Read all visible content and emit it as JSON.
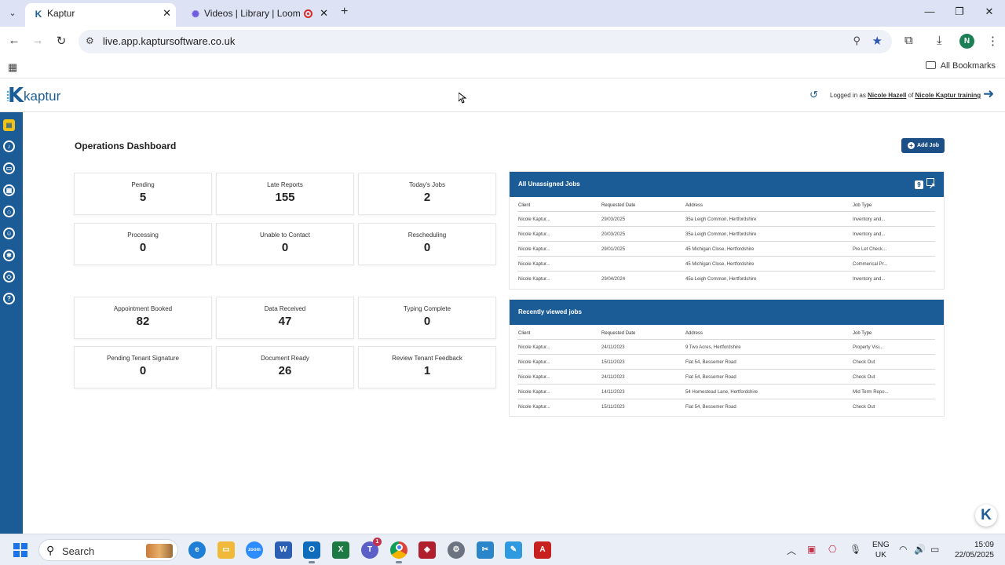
{
  "browser": {
    "tabs": [
      {
        "title": "Kaptur",
        "active": true
      },
      {
        "title": "Videos | Library | Loom",
        "active": false
      }
    ],
    "url": "live.app.kaptursoftware.co.uk",
    "profile_initial": "N",
    "bookmarks_label": "All Bookmarks"
  },
  "header": {
    "logo_text": "kaptur",
    "logged_in_prefix": "Logged in as ",
    "user_name": "Nicole Hazell",
    "of_text": " of ",
    "org_name": "Nicole Kaptur training"
  },
  "main": {
    "title": "Operations Dashboard",
    "add_job_label": "Add Job",
    "stats_top": [
      {
        "label": "Pending",
        "value": "5"
      },
      {
        "label": "Late Reports",
        "value": "155"
      },
      {
        "label": "Today's Jobs",
        "value": "2"
      },
      {
        "label": "Processing",
        "value": "0"
      },
      {
        "label": "Unable to Contact",
        "value": "0"
      },
      {
        "label": "Rescheduling",
        "value": "0"
      }
    ],
    "stats_bottom": [
      {
        "label": "Appointment Booked",
        "value": "82"
      },
      {
        "label": "Data Received",
        "value": "47"
      },
      {
        "label": "Typing Complete",
        "value": "0"
      },
      {
        "label": "Pending Tenant Signature",
        "value": "0"
      },
      {
        "label": "Document Ready",
        "value": "26"
      },
      {
        "label": "Review Tenant Feedback",
        "value": "1"
      }
    ],
    "unassigned": {
      "title": "All Unassigned Jobs",
      "count": "9",
      "columns": [
        "Client",
        "Requested Date",
        "Address",
        "Job Type"
      ],
      "rows": [
        [
          "Nicole Kaptur...",
          "29/03/2025",
          "35a Leigh Common, Hertfordshire",
          "Inventory and..."
        ],
        [
          "Nicole Kaptur...",
          "20/03/2025",
          "35a Leigh Common, Hertfordshire",
          "Inventory and..."
        ],
        [
          "Nicole Kaptur...",
          "29/01/2025",
          "45 Michigan Close, Hertfordshire",
          "Pre Let Check..."
        ],
        [
          "Nicole Kaptur...",
          "",
          "45 Michigan Close, Hertfordshire",
          "Commerical Pr..."
        ],
        [
          "Nicole Kaptur...",
          "29/04/2024",
          "45a Leigh Common, Hertfordshire",
          "Inventory and..."
        ]
      ]
    },
    "recent": {
      "title": "Recently viewed jobs",
      "columns": [
        "Client",
        "Requested Date",
        "Address",
        "Job Type"
      ],
      "rows": [
        [
          "Nicole Kaptur...",
          "24/11/2023",
          "9 Two Acres, Hertfordshire",
          "Property Visi..."
        ],
        [
          "Nicole Kaptur...",
          "15/11/2023",
          "Flat 54, Bessemer Road",
          "Check Out"
        ],
        [
          "Nicole Kaptur...",
          "24/11/2023",
          "Flat 54, Bessemer Road",
          "Check Out"
        ],
        [
          "Nicole Kaptur...",
          "14/11/2023",
          "54 Homestead Lane, Hertfordshire",
          "Mid Term Repo..."
        ],
        [
          "Nicole Kaptur...",
          "15/11/2023",
          "Flat 54, Bessemer Road",
          "Check Out"
        ]
      ]
    }
  },
  "taskbar": {
    "search_label": "Search",
    "lang_line1": "ENG",
    "lang_line2": "UK",
    "time": "15:09",
    "date": "22/05/2025",
    "teams_badge": "1"
  },
  "colors": {
    "brand": "#1c5c96",
    "accent_active": "#f2c314",
    "button": "#1c4f86"
  }
}
